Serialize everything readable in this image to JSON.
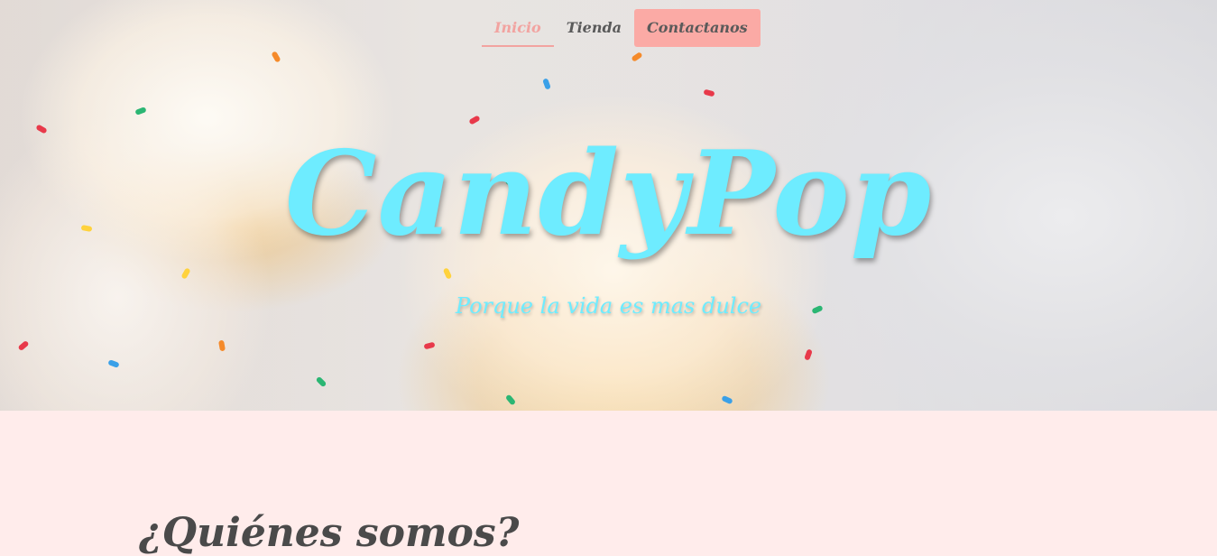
{
  "nav": {
    "items": [
      {
        "label": "Inicio",
        "active": true
      },
      {
        "label": "Tienda",
        "active": false
      },
      {
        "label": "Contactanos",
        "active": false
      }
    ]
  },
  "hero": {
    "title": "CandyPop",
    "tagline": "Porque la vida es mas dulce",
    "background_image": "cupcakes-with-sprinkles"
  },
  "about": {
    "heading": "¿Quiénes somos?"
  },
  "colors": {
    "accent_pink": "#fbaaa5",
    "title_cyan": "#6eecff",
    "section_bg": "#ffeceb",
    "text_dark": "#4a4a4a"
  }
}
